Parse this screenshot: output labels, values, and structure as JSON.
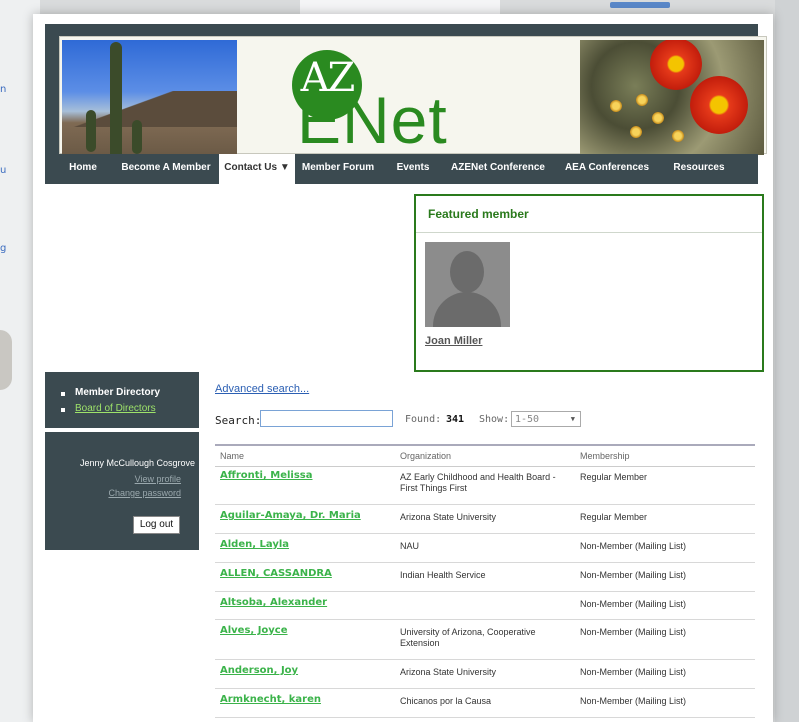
{
  "background_ghost": [
    "n",
    "u",
    "g"
  ],
  "brand": {
    "logo_top": "AZ",
    "logo_bottom": "ENet",
    "accent": "#2a8a20",
    "nav_bg": "#3b4a50"
  },
  "nav": [
    {
      "label": "Home"
    },
    {
      "label": "Become A Member"
    },
    {
      "label": "Contact Us ▼"
    },
    {
      "label": "Member Forum"
    },
    {
      "label": "Events"
    },
    {
      "label": "AZENet Conference"
    },
    {
      "label": "AEA Conferences"
    },
    {
      "label": "Resources"
    }
  ],
  "featured": {
    "title": "Featured member",
    "name": "Joan Miller"
  },
  "sidebar": {
    "items": [
      {
        "label": "Member Directory"
      },
      {
        "label": "Board of Directors"
      }
    ],
    "user": {
      "name": "Jenny McCullough Cosgrove",
      "view_profile": "View profile",
      "change_password": "Change password",
      "logout": "Log out"
    }
  },
  "search": {
    "advanced_link": "Advanced search...",
    "label": "Search:",
    "value": "",
    "found_label": "Found:",
    "found_count": "341",
    "show_label": "Show:",
    "show_value": "1-50"
  },
  "table": {
    "headers": [
      "Name",
      "Organization",
      "Membership"
    ],
    "rows": [
      {
        "name": "Affronti, Melissa",
        "org": "AZ Early Childhood and Health Board - First Things First",
        "membership": "Regular Member"
      },
      {
        "name": "Aguilar-Amaya, Dr. Maria",
        "org": "Arizona State University",
        "membership": "Regular Member"
      },
      {
        "name": "Alden, Layla",
        "org": "NAU",
        "membership": "Non-Member (Mailing List)"
      },
      {
        "name": "ALLEN, CASSANDRA",
        "org": "Indian Health Service",
        "membership": "Non-Member (Mailing List)"
      },
      {
        "name": "Altsoba, Alexander",
        "org": "",
        "membership": "Non-Member (Mailing List)"
      },
      {
        "name": "Alves, Joyce",
        "org": "University of Arizona, Cooperative Extension",
        "membership": "Non-Member (Mailing List)"
      },
      {
        "name": "Anderson, Joy",
        "org": "Arizona State University",
        "membership": "Non-Member (Mailing List)"
      },
      {
        "name": "Armknecht, karen",
        "org": "Chicanos por la Causa",
        "membership": "Non-Member (Mailing List)"
      }
    ]
  }
}
